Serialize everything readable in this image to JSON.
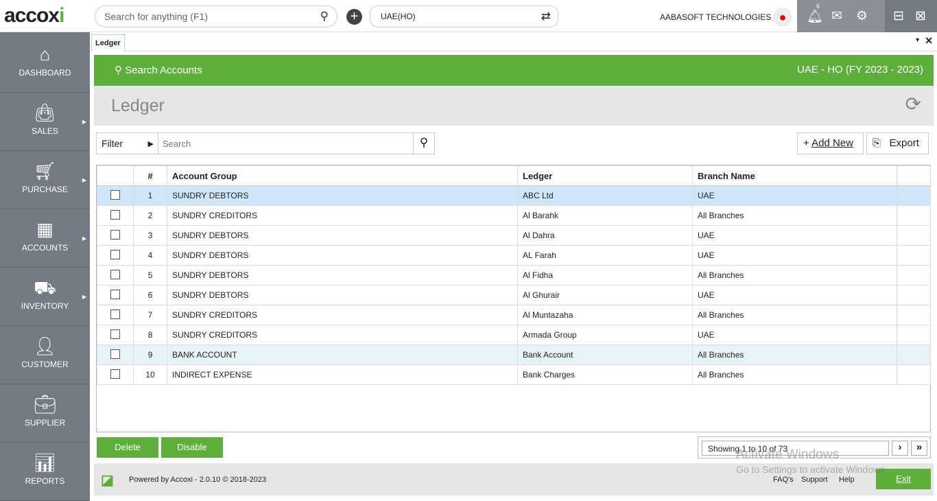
{
  "app": {
    "logo": "accoxi",
    "search_placeholder": "Search for anything (F1)",
    "branch": "UAE(HO)",
    "company": "AABASOFT TECHNOLOGIES",
    "notification_count": "6"
  },
  "sidebar": {
    "items": [
      {
        "label": "DASHBOARD",
        "icon": "home-icon"
      },
      {
        "label": "SALES",
        "icon": "shopping-bag-icon"
      },
      {
        "label": "PURCHASE",
        "icon": "cart-icon"
      },
      {
        "label": "ACCOUNTS",
        "icon": "calculator-icon"
      },
      {
        "label": "INVENTORY",
        "icon": "inventory-icon"
      },
      {
        "label": "CUSTOMER",
        "icon": "user-icon"
      },
      {
        "label": "SUPPLIER",
        "icon": "briefcase-icon"
      },
      {
        "label": "REPORTS",
        "icon": "chart-icon"
      }
    ]
  },
  "tab": {
    "label": "Ledger"
  },
  "header": {
    "search_accounts": "Search Accounts",
    "fy": "UAE - HO (FY 2023 - 2023)",
    "title": "Ledger"
  },
  "toolbar": {
    "filter": "Filter",
    "search_placeholder": "Search",
    "add_new": "Add New",
    "export": "Export"
  },
  "table": {
    "columns": [
      "#",
      "Account Group",
      "Ledger",
      "Branch Name"
    ],
    "rows": [
      [
        "1",
        "SUNDRY DEBTORS",
        "ABC Ltd",
        "UAE"
      ],
      [
        "2",
        "SUNDRY CREDITORS",
        "Al Barahk",
        "All Branches"
      ],
      [
        "3",
        "SUNDRY DEBTORS",
        "Al Dahra",
        "UAE"
      ],
      [
        "4",
        "SUNDRY DEBTORS",
        "AL Farah",
        "UAE"
      ],
      [
        "5",
        "SUNDRY DEBTORS",
        "Al Fidha",
        "All Branches"
      ],
      [
        "6",
        "SUNDRY DEBTORS",
        "Al Ghurair",
        "UAE"
      ],
      [
        "7",
        "SUNDRY CREDITORS",
        "Al Muntazaha",
        "All Branches"
      ],
      [
        "8",
        "SUNDRY CREDITORS",
        "Armada Group",
        "UAE"
      ],
      [
        "9",
        "BANK ACCOUNT",
        "Bank Account",
        "All Branches"
      ],
      [
        "10",
        "INDIRECT EXPENSE",
        "Bank Charges",
        "All Branches"
      ]
    ]
  },
  "actions": {
    "delete": "Delete",
    "disable": "Disable"
  },
  "pager": {
    "text": "Showing 1 to 10 of 73"
  },
  "footer": {
    "powered": "Powered by Accoxi - 2.0.10 © 2018-2023",
    "faq": "FAQ's",
    "support": "Support",
    "help": "Help",
    "exit": "Exit"
  },
  "watermark": {
    "line1": "Activate Windows",
    "line2": "Go to Settings to activate Windows."
  },
  "colors": {
    "accent": "#5dae3b",
    "sidebar": "#737b83"
  }
}
